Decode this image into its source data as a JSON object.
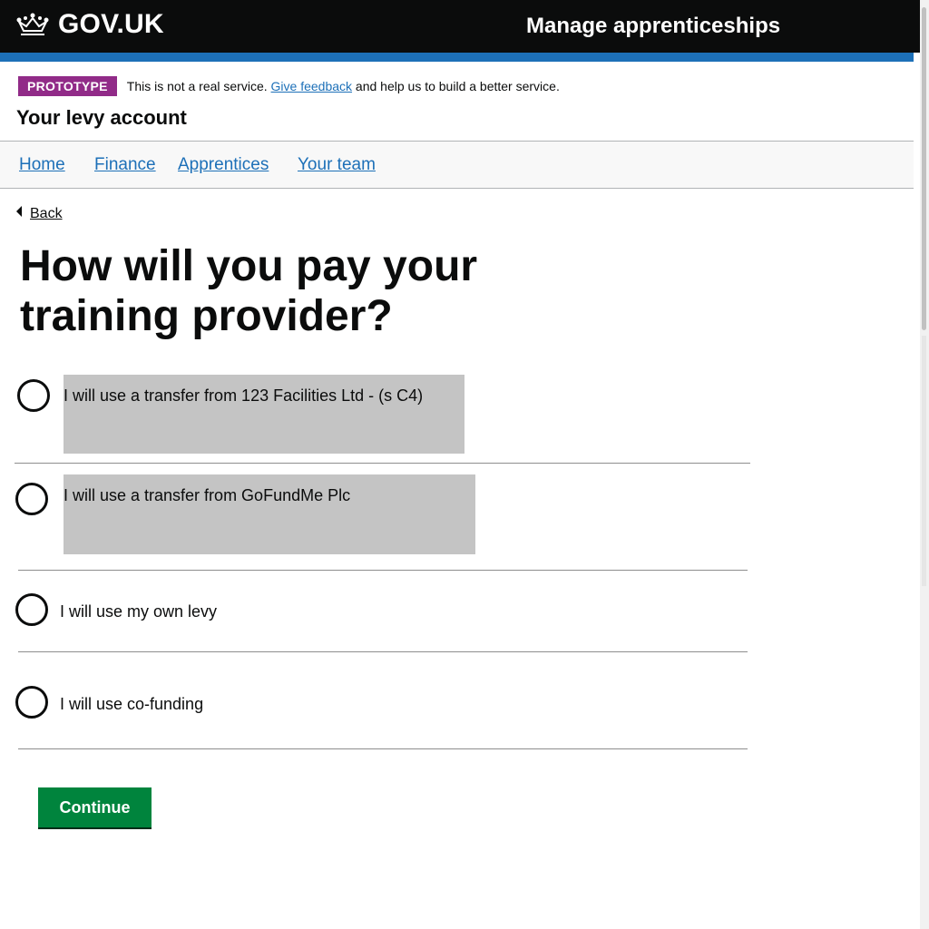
{
  "header": {
    "logo_text": "GOV.UK",
    "service_name": "Manage apprenticeships"
  },
  "phase_banner": {
    "tag": "PROTOTYPE",
    "text_before": "This is not a real service.",
    "link": "Give feedback",
    "text_after": "and help us to build a better service."
  },
  "account_title": "Your levy account",
  "nav": {
    "items": [
      {
        "label": "Home"
      },
      {
        "label": "Finance"
      },
      {
        "label": "Apprentices"
      },
      {
        "label": "Your team"
      }
    ]
  },
  "back_link": "Back",
  "page_title": "How will you pay your training provider?",
  "options": [
    {
      "label": "I will use a transfer from 123 Facilities Ltd - (s C4)"
    },
    {
      "label": "I will use a transfer from GoFundMe Plc"
    },
    {
      "label": "I will use my own levy"
    },
    {
      "label": "I will use co-funding"
    }
  ],
  "continue_label": "Continue",
  "colors": {
    "header_bg": "#0b0c0c",
    "header_stripe": "#1d70b8",
    "prototype_tag": "#912b88",
    "link": "#1d70b8",
    "continue_button": "#00843d",
    "highlight_box": "#c4c4c4"
  }
}
